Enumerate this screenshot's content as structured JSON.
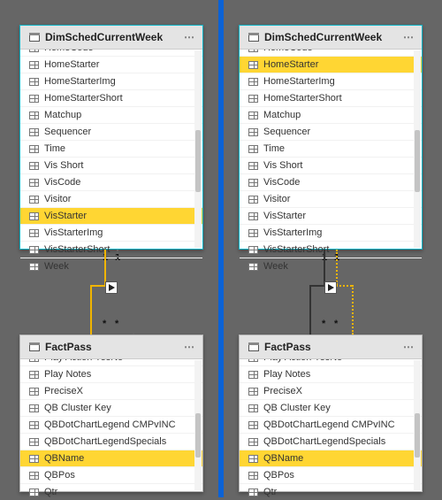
{
  "tables": {
    "dim": {
      "title": "DimSchedCurrentWeek",
      "fields": [
        "HomeCode",
        "HomeStarter",
        "HomeStarterImg",
        "HomeStarterShort",
        "Matchup",
        "Sequencer",
        "Time",
        "Vis Short",
        "VisCode",
        "Visitor",
        "VisStarter",
        "VisStarterImg",
        "VisStarterShort",
        "Week"
      ]
    },
    "fact": {
      "title": "FactPass",
      "fields": [
        "Play Action YesNo",
        "Play Notes",
        "PreciseX",
        "QB Cluster Key",
        "QBDotChartLegend CMPvINC",
        "QBDotChartLegendSpecials",
        "QBName",
        "QBPos",
        "Qtr"
      ]
    }
  },
  "left": {
    "dim_selected": "VisStarter",
    "fact_selected": "QBName"
  },
  "right": {
    "dim_selected": "HomeStarter",
    "fact_selected": "QBName"
  },
  "rel": {
    "one": "1",
    "many": "*"
  }
}
